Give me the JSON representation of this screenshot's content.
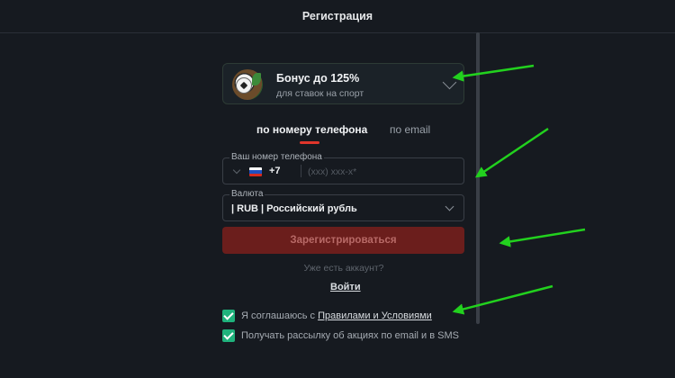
{
  "header": {
    "title": "Регистрация"
  },
  "bonus": {
    "title": "Бонус до 125%",
    "subtitle": "для ставок на спорт"
  },
  "tabs": [
    {
      "label": "по номеру телефона",
      "active": true
    },
    {
      "label": "по email",
      "active": false
    }
  ],
  "phone": {
    "legend": "Ваш номер телефона",
    "code": "+7",
    "placeholder": "(xxx) xxx-x*"
  },
  "currency": {
    "legend": "Валюта",
    "value": "| RUB | Российский рубль"
  },
  "register": {
    "label": "Зарегистрироваться"
  },
  "login": {
    "prompt": "Уже есть аккаунт?",
    "link": "Войти"
  },
  "agreements": {
    "terms_prefix": "Я соглашаюсь с ",
    "terms_link": "Правилами и Условиями",
    "terms_checked": true,
    "newsletter": "Получать рассылку об акциях по email и в SMS",
    "newsletter_checked": true
  },
  "colors": {
    "accent_red": "#e0352b",
    "button_bg": "#6b1e1c",
    "check_green": "#1fb27c",
    "arrow_green": "#22d11e",
    "background": "#161a20"
  },
  "icons": [
    "bonus-sports-icon",
    "chevron-down-icon",
    "russia-flag-icon",
    "checkmark-icon"
  ]
}
